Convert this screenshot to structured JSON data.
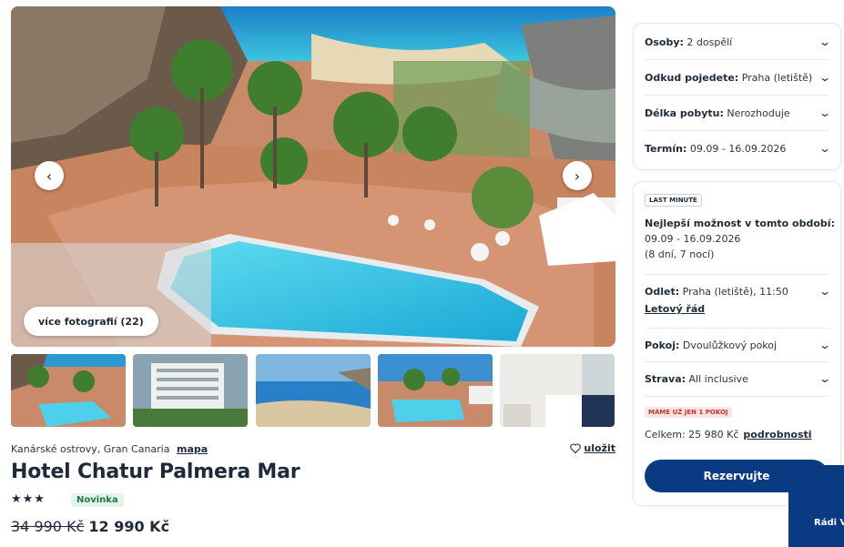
{
  "gallery": {
    "more_photos_label": "více fotografií (22)",
    "prev_icon": "‹",
    "next_icon": "›"
  },
  "hotel": {
    "location": "Kanárské ostrovy, Gran Canaria",
    "map_link": "mapa",
    "save_label": "uložit",
    "name": "Hotel Chatur Palmera Mar",
    "stars": "★★★",
    "star_count": 3,
    "badge": "Novinka",
    "old_price": "34 990 Kč",
    "price": "12 990 Kč"
  },
  "filters": {
    "persons_label": "Osoby:",
    "persons_value": "2 dospělí",
    "departure_label": "Odkud pojedete:",
    "departure_value": "Praha (letiště)",
    "length_label": "Délka pobytu:",
    "length_value": "Nerozhoduje",
    "date_label": "Termín:",
    "date_value": "09.09 - 16.09.2026"
  },
  "offer": {
    "tag": "LAST MINUTE",
    "best_title": "Nejlepší možnost v tomto období:",
    "best_dates": "09.09 - 16.09.2026",
    "best_duration": "(8 dní, 7 nocí)",
    "flight_label": "Odlet:",
    "flight_value": "Praha (letiště), 11:50",
    "flight_link": "Letový řád",
    "room_label": "Pokoj:",
    "room_value": "Dvoulůžkový pokoj",
    "board_label": "Strava:",
    "board_value": "All inclusive",
    "last_room_tag": "MÁME UŽ JEN 1 POKOJ",
    "total_label": "Celkem: 25 980 Kč",
    "details_link": "podrobnosti",
    "reserve_label": "Rezervujte"
  },
  "chat": {
    "label": "Rádi V"
  },
  "colors": {
    "primary": "#0a3a82",
    "badge_green_bg": "#e3f5ea",
    "badge_red_bg": "#fde3e3"
  }
}
